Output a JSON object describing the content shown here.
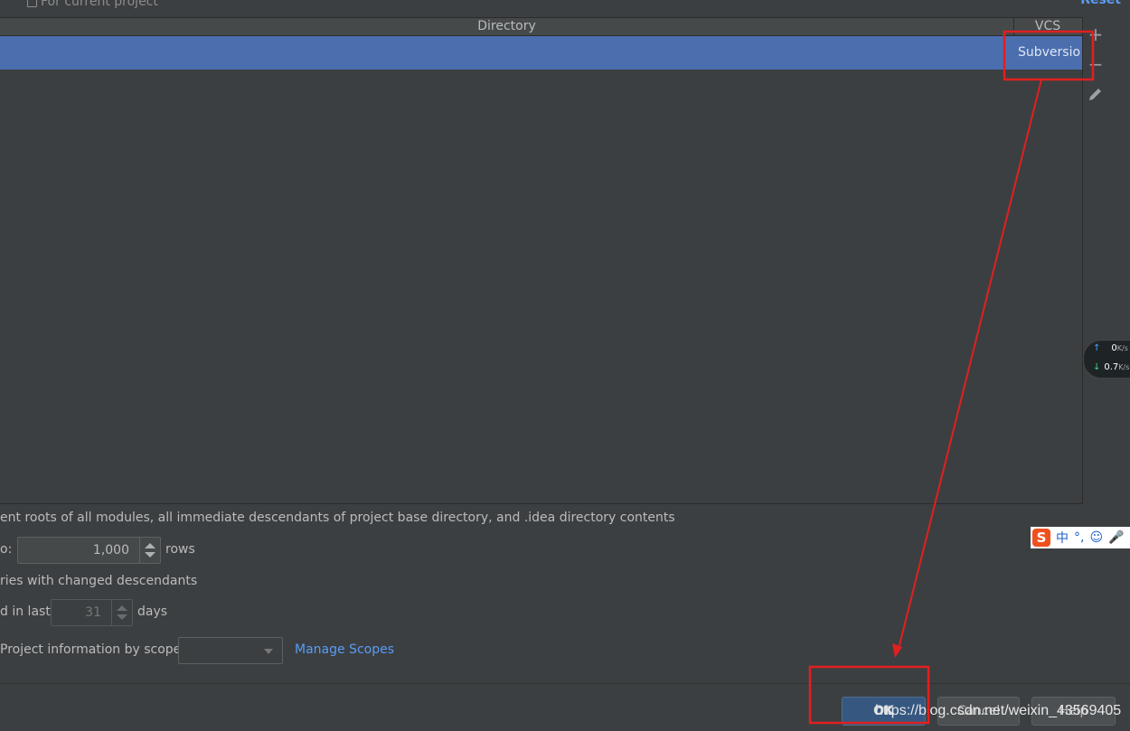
{
  "header": {
    "hint_text": "For current project",
    "reset_label": "Reset"
  },
  "table": {
    "columns": [
      "Directory",
      "VCS"
    ],
    "rows": [
      {
        "directory": "",
        "vcs": "Subversion"
      }
    ],
    "selected_color": "#4b6eaf"
  },
  "toolbar": {
    "add_icon": "plus-icon",
    "remove_icon": "minus-icon",
    "edit_icon": "pencil-icon"
  },
  "network_widget": {
    "up_value": "0",
    "down_value": "0.7",
    "unit": "K/s"
  },
  "ime": {
    "logo": "S",
    "chars": [
      "中",
      "°,",
      "☺",
      "🎤"
    ]
  },
  "options": {
    "content_roots_text": "ent roots of all modules, all immediate descendants of project base directory, and .idea directory contents",
    "limit_prefix": "o:",
    "limit_value": "1,000",
    "limit_suffix": "rows",
    "changed_descendants_text": "ries with changed descendants",
    "days_prefix": "d in last",
    "days_value": "31",
    "days_suffix": "days",
    "scope_text": "Project information by scope",
    "scope_selected": "",
    "manage_scopes_label": "Manage Scopes"
  },
  "buttons": {
    "ok": "OK",
    "cancel": "Cancel",
    "help": "Help"
  },
  "watermark": "https://blog.csdn.net/weixin_43569405",
  "colors": {
    "background": "#3c3f41",
    "link": "#589df6",
    "primary_button": "#365880",
    "annotation": "#e02020"
  }
}
